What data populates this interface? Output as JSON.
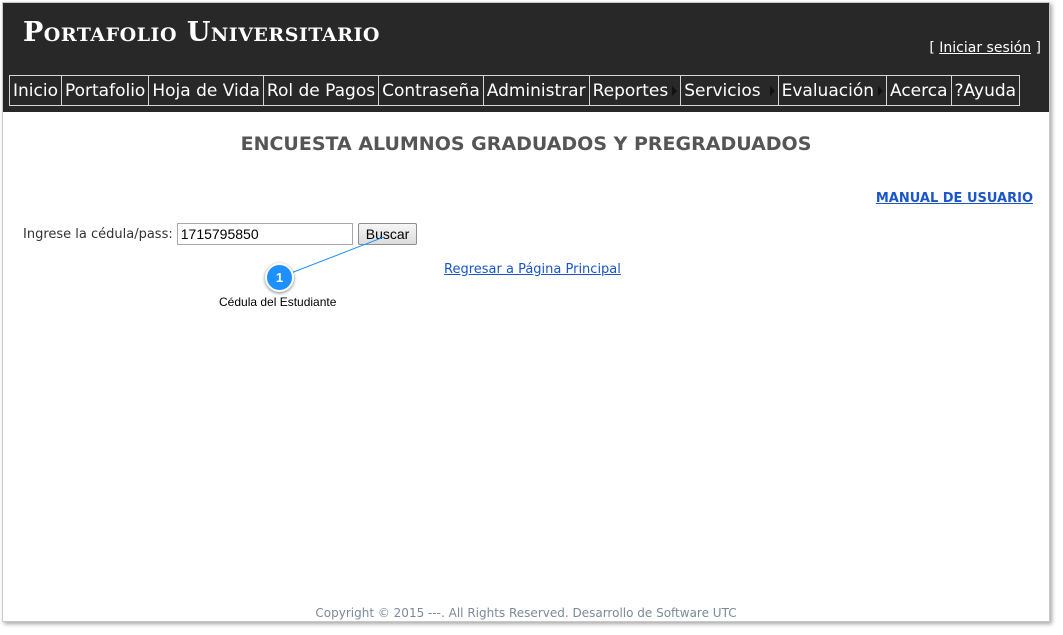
{
  "header": {
    "site_title": "Portafolio Universitario",
    "login_open": "[ ",
    "login_link": "Iniciar sesión",
    "login_close": " ]"
  },
  "menu": {
    "items": [
      {
        "label": "Inicio",
        "has_submenu": false
      },
      {
        "label": "Portafolio",
        "has_submenu": false
      },
      {
        "label": "Hoja de Vida",
        "has_submenu": false
      },
      {
        "label": "Rol de Pagos",
        "has_submenu": false
      },
      {
        "label": "Contraseña",
        "has_submenu": false
      },
      {
        "label": "Administrar",
        "has_submenu": false
      },
      {
        "label": "Reportes",
        "has_submenu": true
      },
      {
        "label": "Servicios",
        "has_submenu": true
      },
      {
        "label": "Evaluación",
        "has_submenu": true
      },
      {
        "label": "Acerca",
        "has_submenu": false
      },
      {
        "label": "?Ayuda",
        "has_submenu": false
      }
    ]
  },
  "main": {
    "heading": "ENCUESTA ALUMNOS GRADUADOS Y PREGRADUADOS",
    "manual_link": "MANUAL DE USUARIO",
    "search_label": "Ingrese la cédula/pass:",
    "search_value": "1715795850",
    "search_button": "Buscar",
    "back_link": "Regresar a Página Principal"
  },
  "annotation": {
    "number": "1",
    "label": "Cédula del Estudiante",
    "color": "#1e90ff"
  },
  "footer": {
    "text": "Copyright © 2015 ---. All Rights Reserved. Desarrollo de Software UTC"
  },
  "colors": {
    "header_bg": "#282828",
    "link": "#1a55c9",
    "heading": "#555555"
  }
}
